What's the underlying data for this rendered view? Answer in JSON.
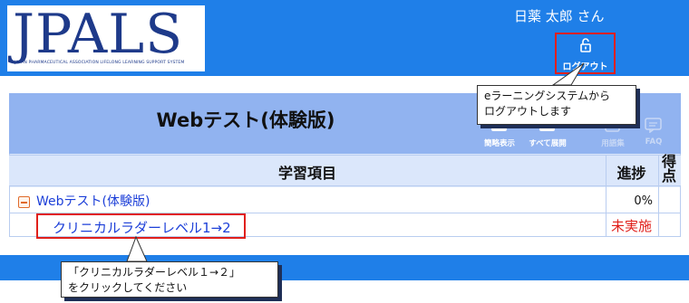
{
  "header": {
    "logo_text": "JPALS",
    "logo_subtitle": "JAPAN PHARMACEUTICAL ASSOCIATION LIFELONG LEARNING SUPPORT SYSTEM",
    "user_name": "日薬 太郎 さん",
    "logout_label": "ログアウト"
  },
  "panel": {
    "title": "Webテスト(体験版)",
    "tools": [
      {
        "label": "簡略表示",
        "icon": "compact-view-icon"
      },
      {
        "label": "すべて展開",
        "icon": "expand-all-icon"
      },
      {
        "label": "用語集",
        "icon": "glossary-icon"
      },
      {
        "label": "FAQ",
        "icon": "faq-icon"
      }
    ]
  },
  "table": {
    "headers": {
      "item": "学習項目",
      "progress": "進捗",
      "score": "得点"
    },
    "rows": [
      {
        "label": "Webテスト(体験版)",
        "progress": "0%",
        "icon": "collapse-minus-icon"
      },
      {
        "label": "クリニカルラダーレベル1→2",
        "status": "未実施"
      }
    ]
  },
  "callouts": {
    "logout_hint": [
      "eラーニングシステムから",
      "ログアウトします"
    ],
    "item_hint": [
      "「クリニカルラダーレベル１→２」",
      "をクリックしてください"
    ]
  },
  "colors": {
    "header_blue": "#1f7fe8",
    "title_band": "#91b3f0",
    "table_bg": "#dbe7fb",
    "highlight_red": "#e0201b",
    "link_blue": "#1c3fd8"
  }
}
